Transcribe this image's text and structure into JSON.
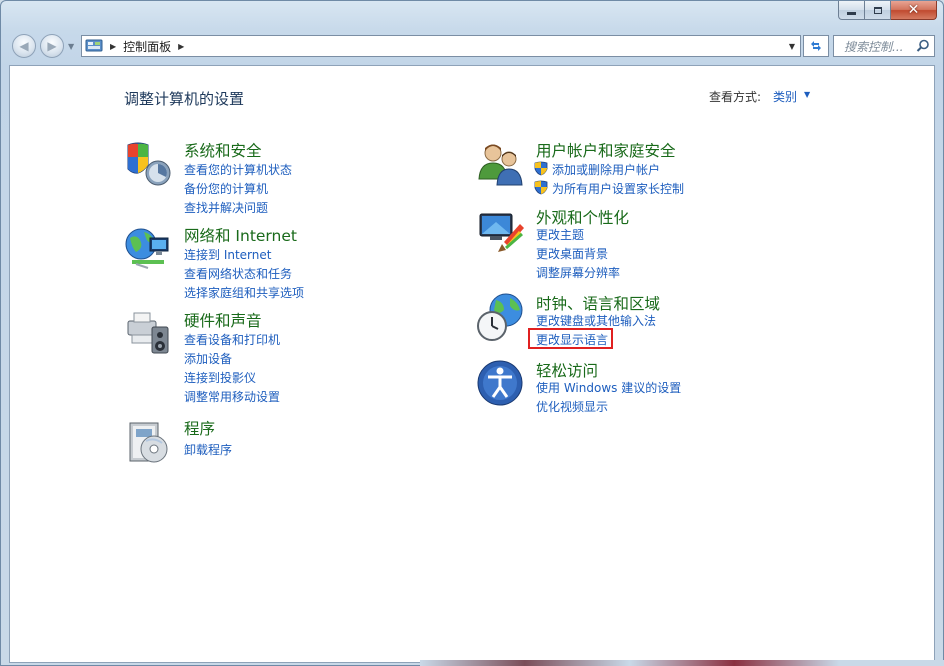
{
  "window": {
    "caption": {
      "minimize": "minimize",
      "maximize": "maximize",
      "close": "close"
    }
  },
  "nav": {
    "breadcrumb": [
      "控制面板"
    ],
    "search_placeholder": "搜索控制..."
  },
  "main": {
    "title": "调整计算机的设置",
    "view_by_label": "查看方式:",
    "view_by_value": "类别"
  },
  "categories": [
    {
      "title": "系统和安全",
      "icon": "system-security-icon",
      "links": [
        "查看您的计算机状态",
        "备份您的计算机",
        "查找并解决问题"
      ]
    },
    {
      "title": "网络和 Internet",
      "icon": "network-icon",
      "links": [
        "连接到 Internet",
        "查看网络状态和任务",
        "选择家庭组和共享选项"
      ]
    },
    {
      "title": "硬件和声音",
      "icon": "hardware-sound-icon",
      "links": [
        "查看设备和打印机",
        "添加设备",
        "连接到投影仪",
        "调整常用移动设置"
      ]
    },
    {
      "title": "程序",
      "icon": "programs-icon",
      "links": [
        "卸载程序"
      ]
    },
    {
      "title": "用户帐户和家庭安全",
      "icon": "user-accounts-icon",
      "links": [
        "添加或删除用户帐户",
        "为所有用户设置家长控制"
      ]
    },
    {
      "title": "外观和个性化",
      "icon": "appearance-icon",
      "links": [
        "更改主题",
        "更改桌面背景",
        "调整屏幕分辨率"
      ]
    },
    {
      "title": "时钟、语言和区域",
      "icon": "clock-language-icon",
      "links": [
        "更改键盘或其他输入法",
        "更改显示语言"
      ]
    },
    {
      "title": "轻松访问",
      "icon": "ease-of-access-icon",
      "links": [
        "使用 Windows 建议的设置",
        "优化视频显示"
      ]
    }
  ],
  "colors": {
    "category_title": "#196a1a",
    "link": "#1e5ebe",
    "title": "#1e395b",
    "highlight_box": "#e02020"
  }
}
